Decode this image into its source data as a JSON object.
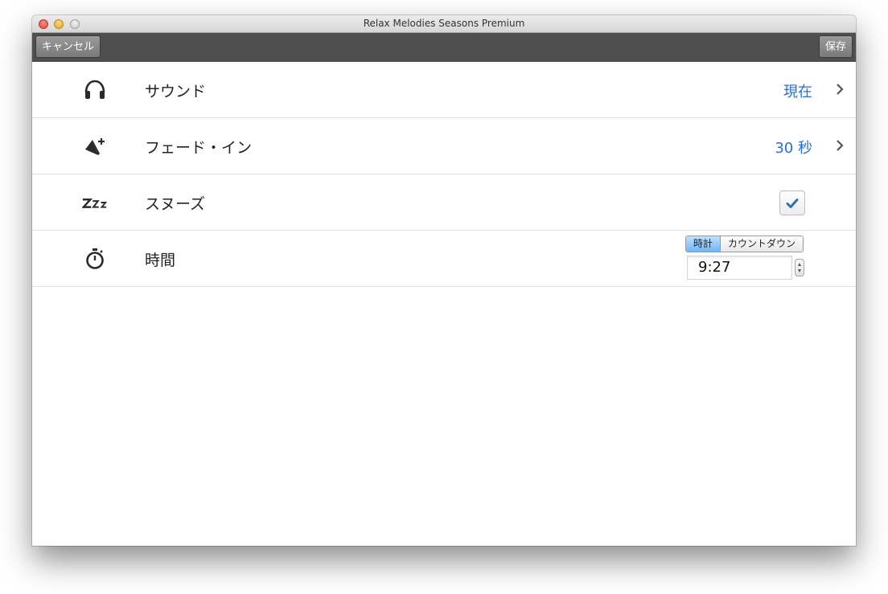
{
  "window": {
    "title": "Relax Melodies Seasons Premium"
  },
  "toolbar": {
    "cancel_label": "キャンセル",
    "save_label": "保存"
  },
  "settings": {
    "sound": {
      "icon": "headphones-icon",
      "label": "サウンド",
      "value": "現在"
    },
    "fade_in": {
      "icon": "volume-up-icon",
      "label": "フェード・イン",
      "value": "30 秒"
    },
    "snooze": {
      "icon": "zzz-icon",
      "label": "スヌーズ",
      "checked": true
    },
    "time": {
      "icon": "stopwatch-icon",
      "label": "時間",
      "modes": [
        "時計",
        "カウントダウン"
      ],
      "active_mode": "時計",
      "value": "9:27"
    }
  },
  "colors": {
    "accent_blue": "#2a6fd6",
    "toolbar_bg": "#4f4f4f",
    "segment_active": "#6fb6f6"
  }
}
